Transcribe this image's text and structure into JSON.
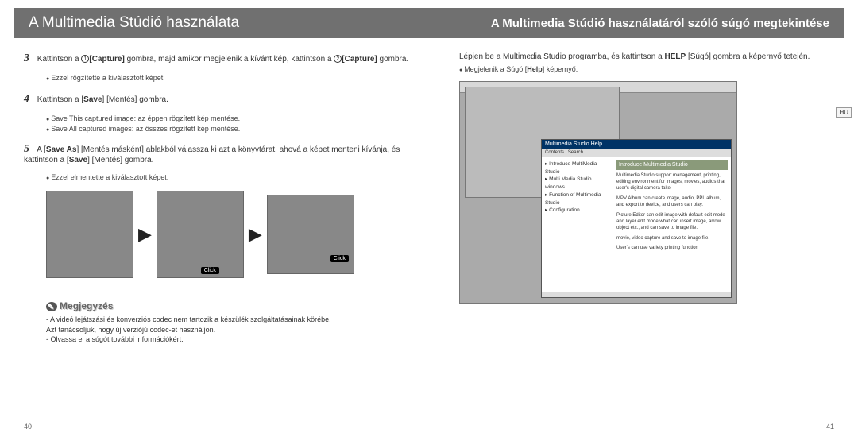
{
  "header": {
    "left": "A Multimedia Stúdió használata",
    "right": "A Multimedia Stúdió használatáról szóló súgó megtekintése"
  },
  "steps": {
    "s3": {
      "num": "3",
      "pre": "Kattintson a ",
      "cap1": "[Capture]",
      "mid": " gombra, majd amikor megjelenik a kívánt kép, kattintson a ",
      "cap2": "[Capture]",
      "end": " gombra."
    },
    "s3b": "Ezzel rögzítette a kiválasztott képet.",
    "s4": {
      "num": "4",
      "pre": "Kattintson a [",
      "save": "Save",
      "post": "] [Mentés] gombra."
    },
    "s4b1": "Save This captured image: az éppen rögzített kép mentése.",
    "s4b2": "Save All captured images: az összes rögzített kép mentése.",
    "s5": {
      "num": "5",
      "pre": "A [",
      "sa": "Save As",
      "mid": "] [Mentés másként] ablakból válassza ki azt a könyvtárat, ahová a képet menteni kívánja, és kattintson a [",
      "sv": "Save",
      "end": "] [Mentés] gombra."
    },
    "s5b": "Ezzel elmentette a kiválasztott képet."
  },
  "note": {
    "title": "Megjegyzés",
    "l1": "- A videó lejátszási és konverziós codec nem tartozik a készülék szolgáltatásainak körébe.",
    "l2": "  Azt tanácsoljuk, hogy új verziójú codec-et használjon.",
    "l3": "- Olvassa el a súgót további információkért."
  },
  "right": {
    "intro_pre": "Lépjen be a Multimedia Studio programba, és kattintson a ",
    "help": "HELP",
    "intro_post": " [Súgó] gombra a képernyő tetején.",
    "b1_pre": "Megjelenik a Súgó [",
    "b1_h": "Help",
    "b1_post": "] képernyő."
  },
  "help": {
    "win_title": "Multimedia Studio Help",
    "tabs": "Contents | Search",
    "tree1": "▸ Introduce MultiMedia Studio",
    "tree2": "▸ Multi Media Studio windows",
    "tree3": "▸ Function of Multimedia Studio",
    "tree4": "▸ Configuration",
    "panel_title": "Introduce Multimedia Studio",
    "p1": "Multimedia Studio support management, printing, editing environment for images, movies, audios that user's digital camera take.",
    "p2": "MPV Album can create image, audio, PPL album, and export to device, and users can play.",
    "p3": "Picture Editor can edit image with default edit mode and layer edit mode what can insert image, arrow object etc., and can save to image file.",
    "p4": "movie, video capture and save to image file.",
    "p5": "User's can use variety printing function"
  },
  "labels": {
    "click": "Click",
    "arrow": "▶",
    "hu": "HU"
  },
  "pages": {
    "left": "40",
    "right": "41"
  }
}
